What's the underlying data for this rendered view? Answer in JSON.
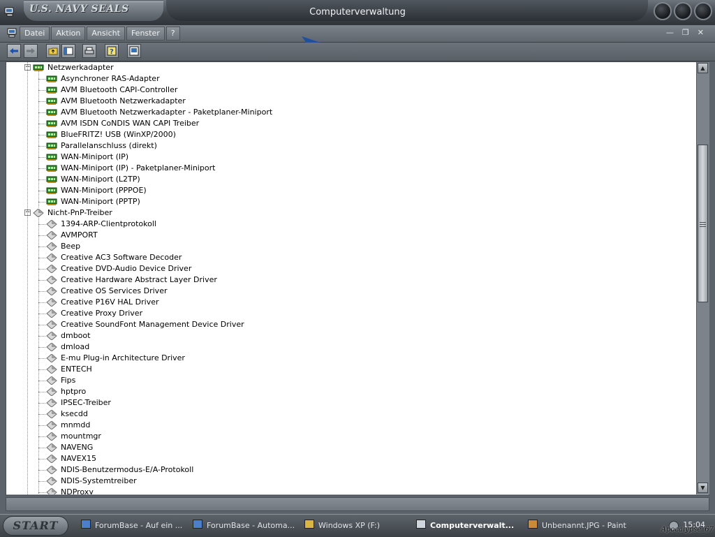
{
  "window": {
    "brand_logo_text": "U.S. NAVY SEALS",
    "title": "Computerverwaltung"
  },
  "menu": {
    "items": [
      "Datei",
      "Aktion",
      "Ansicht",
      "Fenster",
      "?"
    ]
  },
  "toolbar": {
    "buttons": [
      "back-icon",
      "forward-icon",
      "up-folder-icon",
      "show-hide-console-tree-icon",
      "print-icon",
      "help-icon",
      "properties-icon"
    ]
  },
  "tree": {
    "groups": [
      {
        "label": "Netzwerkadapter",
        "icon": "network-adapter-icon",
        "expanded": true,
        "items": [
          "Asynchroner RAS-Adapter",
          "AVM Bluetooth CAPI-Controller",
          "AVM Bluetooth Netzwerkadapter",
          "AVM Bluetooth Netzwerkadapter - Paketplaner-Miniport",
          "AVM ISDN CoNDIS WAN CAPI Treiber",
          "BlueFRITZ! USB (WinXP/2000)",
          "Parallelanschluss (direkt)",
          "WAN-Miniport (IP)",
          "WAN-Miniport (IP) - Paketplaner-Miniport",
          "WAN-Miniport (L2TP)",
          "WAN-Miniport (PPPOE)",
          "WAN-Miniport (PPTP)"
        ]
      },
      {
        "label": "Nicht-PnP-Treiber",
        "icon": "non-pnp-driver-icon",
        "expanded": true,
        "items": [
          "1394-ARP-Clientprotokoll",
          "AVMPORT",
          "Beep",
          "Creative AC3 Software Decoder",
          "Creative DVD-Audio Device Driver",
          "Creative Hardware Abstract Layer Driver",
          "Creative OS Services Driver",
          "Creative P16V HAL Driver",
          "Creative Proxy Driver",
          "Creative SoundFont Management Device Driver",
          "dmboot",
          "dmload",
          "E-mu Plug-in Architecture Driver",
          "ENTECH",
          "Fips",
          "hptpro",
          "IPSEC-Treiber",
          "ksecdd",
          "mnmdd",
          "mountmgr",
          "NAVENG",
          "NAVEX15",
          "NDIS-Benutzermodus-E/A-Protokoll",
          "NDIS-Systemtreiber",
          "NDProxy"
        ]
      }
    ]
  },
  "taskbar": {
    "start_label": "START",
    "tasks": [
      {
        "label": "ForumBase - Auf ein ...",
        "icon": "browser-icon",
        "active": false
      },
      {
        "label": "ForumBase - Automa...",
        "icon": "browser-icon",
        "active": false
      },
      {
        "label": "Windows XP (F:)",
        "icon": "folder-icon",
        "active": false
      },
      {
        "label": "Computerverwalt...",
        "icon": "computer-management-icon",
        "active": true
      },
      {
        "label": "Unbenannt.JPG - Paint",
        "icon": "paint-icon",
        "active": false
      }
    ],
    "clock": "15:04",
    "credit": "Apocalypse_67"
  },
  "colors": {
    "chrome_dark": "#3f454b",
    "chrome_light": "#8d949b",
    "adapter_icon": "#2f8a2f",
    "driver_icon": "#9b9b9b"
  }
}
